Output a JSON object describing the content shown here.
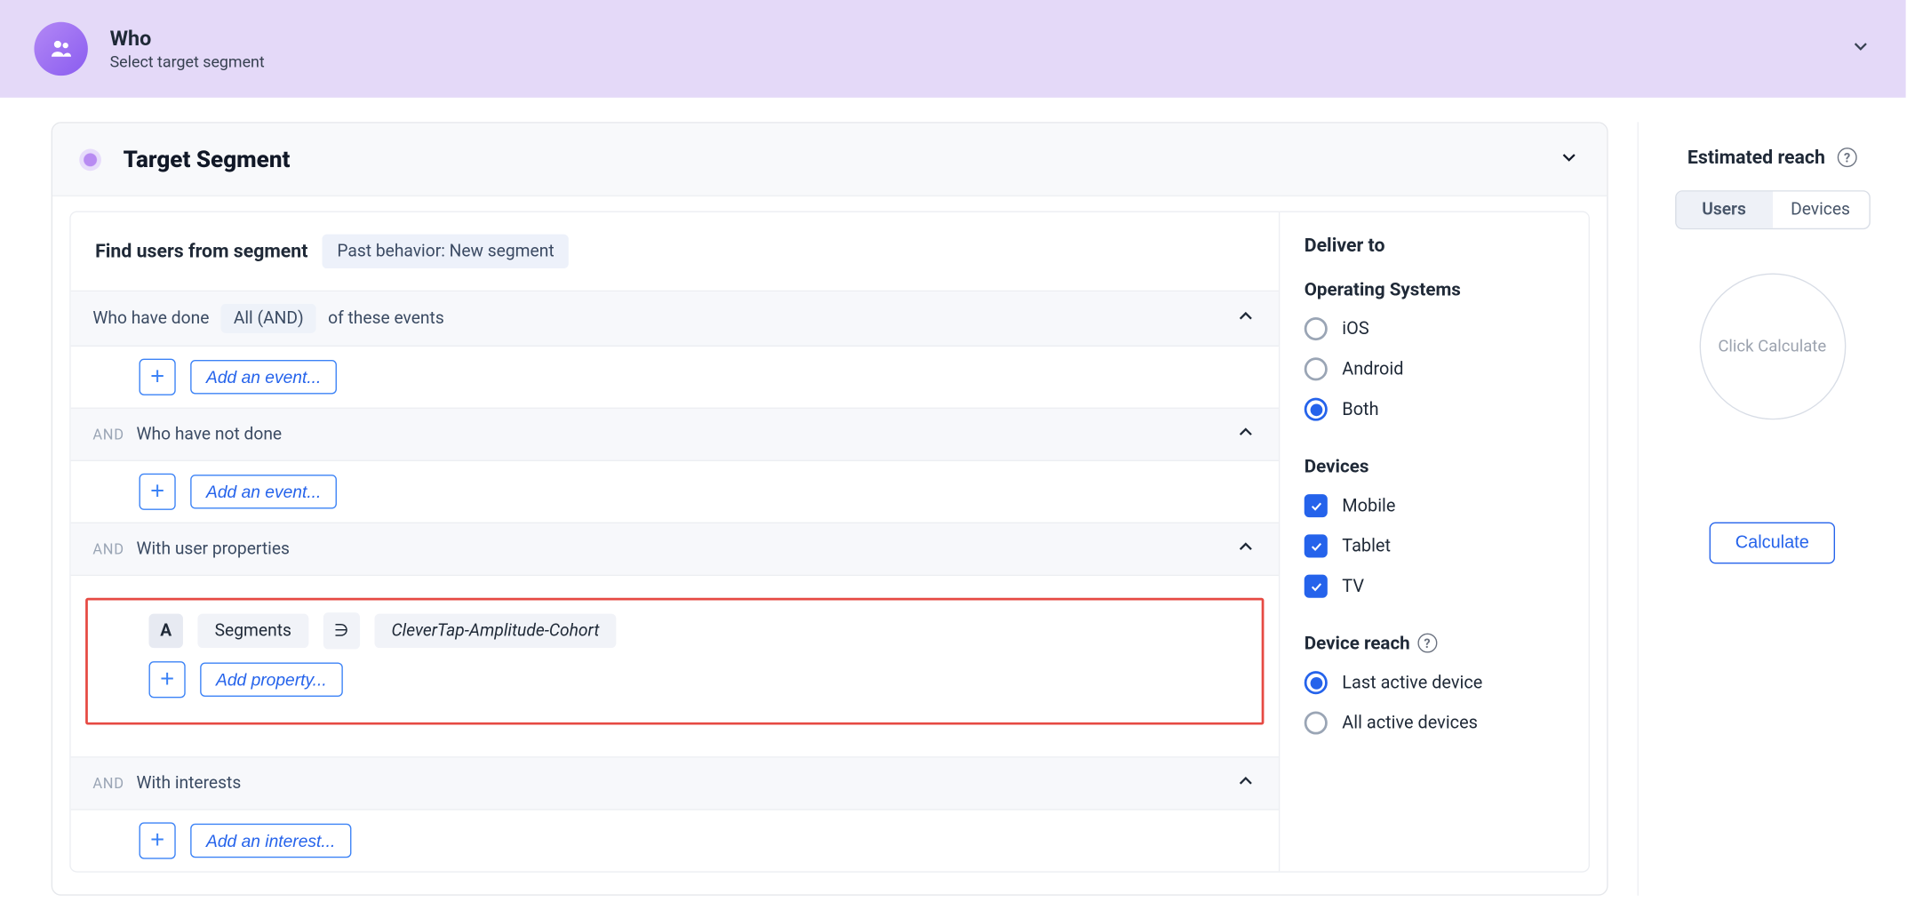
{
  "header": {
    "title": "Who",
    "subtitle": "Select target segment"
  },
  "panel": {
    "title": "Target Segment"
  },
  "find": {
    "label": "Find users from segment",
    "tag": "Past behavior: New segment"
  },
  "sections": {
    "done": {
      "pre": "Who have done",
      "pill": "All (AND)",
      "post": "of these events",
      "add": "Add an event..."
    },
    "notdone": {
      "and": "AND",
      "label": "Who have not done",
      "add": "Add an event..."
    },
    "props": {
      "and": "AND",
      "label": "With user properties",
      "letter": "A",
      "chip": "Segments",
      "op": "∋",
      "value": "CleverTap-Amplitude-Cohort",
      "add": "Add property..."
    },
    "interests": {
      "and": "AND",
      "label": "With interests",
      "add": "Add an interest..."
    }
  },
  "deliver": {
    "title": "Deliver to",
    "os_title": "Operating Systems",
    "os": {
      "ios": "iOS",
      "android": "Android",
      "both": "Both"
    },
    "devices_title": "Devices",
    "devices": {
      "mobile": "Mobile",
      "tablet": "Tablet",
      "tv": "TV"
    },
    "reach_title": "Device reach",
    "reach": {
      "last": "Last active device",
      "all": "All active devices"
    }
  },
  "estimate": {
    "title": "Estimated reach",
    "tabs": {
      "users": "Users",
      "devices": "Devices"
    },
    "placeholder": "Click Calculate",
    "button": "Calculate"
  }
}
